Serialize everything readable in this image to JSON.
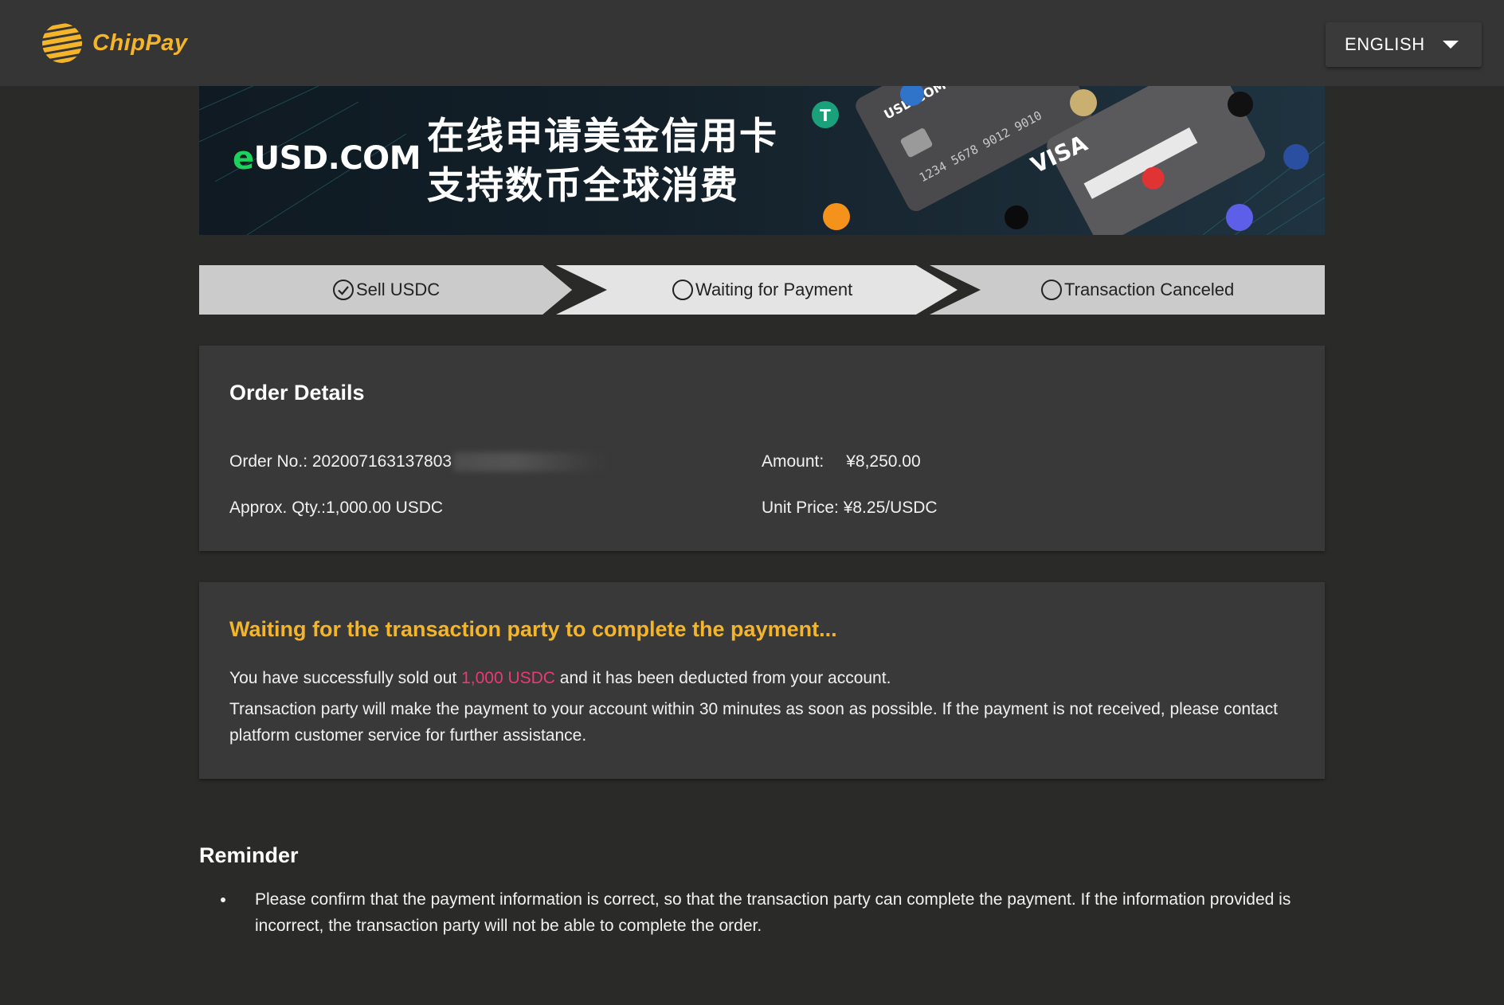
{
  "app": {
    "name": "ChipPay"
  },
  "header": {
    "language_label": "ENGLISH"
  },
  "banner": {
    "brand_e": "e",
    "brand_rest": "USD.COM",
    "line1": "在线申请美金信用卡",
    "line2": "支持数币全球消费",
    "card_brand": "VISA",
    "card_number": "1234 5678 9012 9010",
    "card_site": "USD.COM"
  },
  "stepper": {
    "steps": [
      {
        "label": "Sell USDC",
        "state": "done"
      },
      {
        "label": "Waiting for Payment",
        "state": "active"
      },
      {
        "label": "Transaction Canceled",
        "state": "pending"
      }
    ]
  },
  "order": {
    "title": "Order Details",
    "order_no_label": "Order No.: ",
    "order_no_value": "202007163137803",
    "amount_label": "Amount:",
    "amount_value": "¥8,250.00",
    "qty_label": "Approx. Qty.:",
    "qty_value": "1,000.00 USDC",
    "unit_price_label": "Unit Price: ",
    "unit_price_value": "¥8.25/USDC"
  },
  "waiting": {
    "title": "Waiting for the transaction party to complete the payment...",
    "line1_before": "You have successfully sold out ",
    "line1_highlight": "1,000 USDC",
    "line1_after": " and it has been deducted from your account.",
    "line2": "Transaction party will make the payment to your account within 30 minutes as soon as possible. If the payment is not received, please contact platform customer service for further assistance."
  },
  "reminder": {
    "title": "Reminder",
    "items": [
      "Please confirm that the payment information is correct, so that the transaction party can complete the payment. If the information provided is incorrect, the transaction party will not be able to complete the order."
    ]
  },
  "colors": {
    "accent": "#f5b52a",
    "highlight": "#e83b73",
    "background": "#2a2a28",
    "card": "#393939"
  }
}
